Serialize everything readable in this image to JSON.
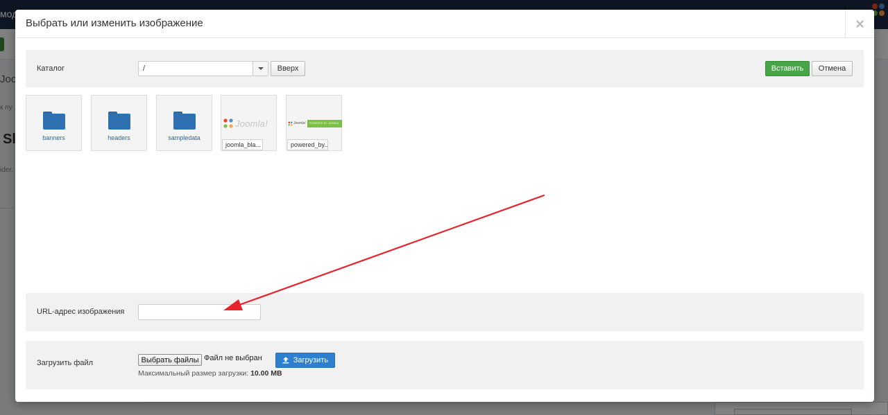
{
  "background": {
    "topbar_title": "мод",
    "breadcrumb_fragment": "Joo",
    "path_fragment": "к пу",
    "heading_fragment": "Sl",
    "text_fragment": "ider."
  },
  "modal": {
    "title": "Выбрать или изменить изображение",
    "close_symbol": "×"
  },
  "catalog": {
    "label": "Каталог",
    "selected_path": "/",
    "up_button": "Вверх",
    "insert_button": "Вставить",
    "cancel_button": "Отмена"
  },
  "files": [
    {
      "name": "banners",
      "type": "folder"
    },
    {
      "name": "headers",
      "type": "folder"
    },
    {
      "name": "sampledata",
      "type": "folder"
    },
    {
      "name": "joomla_bla...",
      "type": "image",
      "logo_text": "Joomla!"
    },
    {
      "name": "powered_by...",
      "type": "image",
      "logo_text": "Joomla!",
      "badge_text": "POWERED BY JOOMLA"
    }
  ],
  "url": {
    "label": "URL-адрес изображения",
    "value": ""
  },
  "upload": {
    "label": "Загрузить файл",
    "choose_button": "Выбрать файлы",
    "no_file": "Файл не выбран",
    "upload_button": "Загрузить",
    "max_size_label": "Максимальный размер загрузки:",
    "max_size_value": "10.00 MB"
  },
  "colors": {
    "insert_green": "#46a546",
    "upload_blue": "#2f7fd0",
    "folder_blue": "#2f70b0",
    "arrow_red": "#e8222a"
  }
}
